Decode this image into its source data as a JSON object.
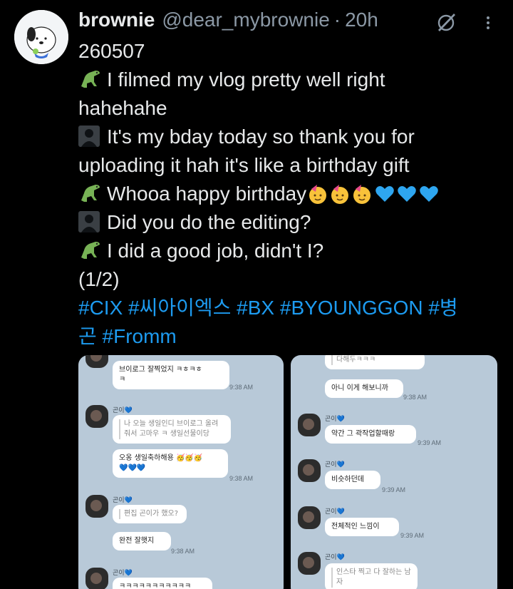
{
  "post": {
    "name": "brownie",
    "handle": "@dear_mybrownie",
    "separator": "·",
    "time": "20h",
    "date_line": "260507",
    "lines": [
      {
        "speaker": "dino-icon",
        "text": "I filmed my vlog pretty well right"
      },
      {
        "speaker": "",
        "text": "hahehahe"
      },
      {
        "speaker": "person-icon",
        "text": "It's my bday today so thank you for"
      },
      {
        "speaker": "",
        "text": "uploading it hah it's like a birthday gift"
      },
      {
        "speaker": "dino-icon",
        "text": "Whooa happy birthday"
      },
      {
        "speaker": "person-icon",
        "text": "Did you do the editing?"
      },
      {
        "speaker": "dino-icon",
        "text": "I did a good job, didn't I?"
      }
    ],
    "part": "(1/2)",
    "hashtags_line1": "#CIX #씨아이엑스 #BX #BYOUNGGON #병",
    "hashtags_line2": "곤 #Fromm"
  },
  "chat_left": {
    "b1": "브이로그 잘찍었지 ㅋㅎㅋㅎ",
    "b1b": "ㅋ",
    "t1": "9:38 AM",
    "sender1": "곤이💙",
    "q1a": "나 오늘 생일인디 브이로그 올려",
    "q1b": "줘서 고마우 ㅋ 생일선물이당",
    "b2": "오옹 생일축하해용",
    "t2": "9:38 AM",
    "sender2": "곤이💙",
    "q2": "편집 곤이가 했오?",
    "b3": "완전 잘햇지",
    "t3": "9:38 AM",
    "sender3": "곤이💙",
    "b4": "ㅋㅋㅋㅋㅋㅋㅋㅋㅋㅋㅋ"
  },
  "chat_right": {
    "top": "다해두ㅋㅋㅋ",
    "b1": "아니 이게 해보니까",
    "t1": "9:38 AM",
    "sender1": "곤이💙",
    "b2": "약간 그 곽작업할때랑",
    "t2": "9:39 AM",
    "sender2": "곤이💙",
    "b3": "비슷하던데",
    "t3": "9:39 AM",
    "sender3": "곤이💙",
    "b4": "전체적인 느낌이",
    "t4": "9:39 AM",
    "sender4": "곤이💙",
    "q4": "인스타 찍고 다 잘하는 남자"
  },
  "colors": {
    "accent": "#1d9bf0",
    "text": "#e7e9ea",
    "muted": "#8b98a5",
    "background": "#000000"
  }
}
